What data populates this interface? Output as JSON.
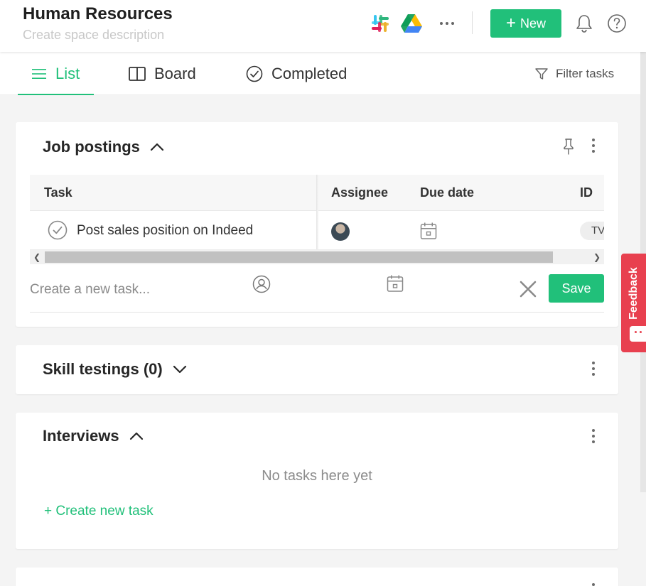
{
  "header": {
    "title": "Human Resources",
    "description_placeholder": "Create space description",
    "integrations": [
      "slack-icon",
      "google-drive-icon"
    ],
    "more_icon": "more-horizontal-icon",
    "new_button": "New",
    "notifications_icon": "bell-icon",
    "help_icon": "help-icon"
  },
  "tabs": {
    "list": "List",
    "board": "Board",
    "completed": "Completed",
    "filter": "Filter tasks",
    "active": "list"
  },
  "sections": {
    "job_postings": {
      "title": "Job postings",
      "columns": {
        "task": "Task",
        "assignee": "Assignee",
        "due_date": "Due date",
        "id": "ID"
      },
      "rows": [
        {
          "task": "Post sales position on Indeed",
          "id": "TV"
        }
      ],
      "new_task_placeholder": "Create a new task...",
      "save_label": "Save"
    },
    "skill_testings": {
      "title": "Skill testings (0)"
    },
    "interviews": {
      "title": "Interviews",
      "empty_text": "No tasks here yet",
      "create_link": "+ Create new task"
    }
  },
  "feedback": {
    "label": "Feedback"
  },
  "colors": {
    "accent": "#21c07a",
    "feedback": "#e8404f"
  }
}
